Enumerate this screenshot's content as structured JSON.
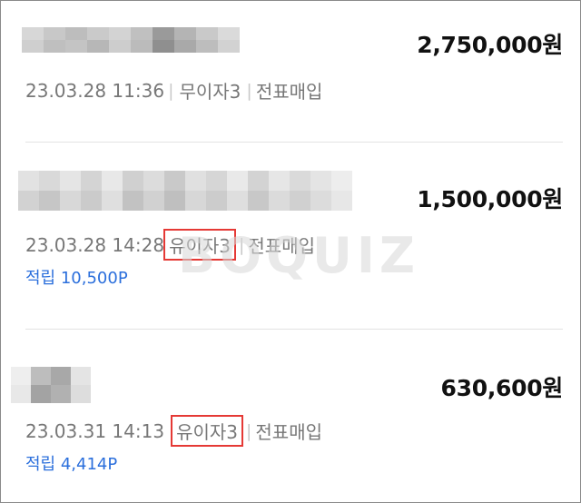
{
  "transactions": [
    {
      "amount": "2,750,000원",
      "date": "23.03.28 11:36",
      "plan": "무이자3",
      "type": "전표매입",
      "points": null,
      "plan_highlighted": false
    },
    {
      "amount": "1,500,000원",
      "date": "23.03.28 14:28",
      "plan": "유이자3",
      "type": "전표매입",
      "points": "적립 10,500P",
      "plan_highlighted": true
    },
    {
      "amount": "630,600원",
      "date": "23.03.31 14:13",
      "plan": "유이자3",
      "type": "전표매입",
      "points": "적립 4,414P",
      "plan_highlighted": true
    }
  ],
  "watermark": {
    "text": "BOQUIZ"
  },
  "colors": {
    "amount": "#111111",
    "meta": "#777777",
    "points": "#2b6fdc",
    "highlight_box": "#e53935",
    "divider": "#e3e3e3"
  }
}
